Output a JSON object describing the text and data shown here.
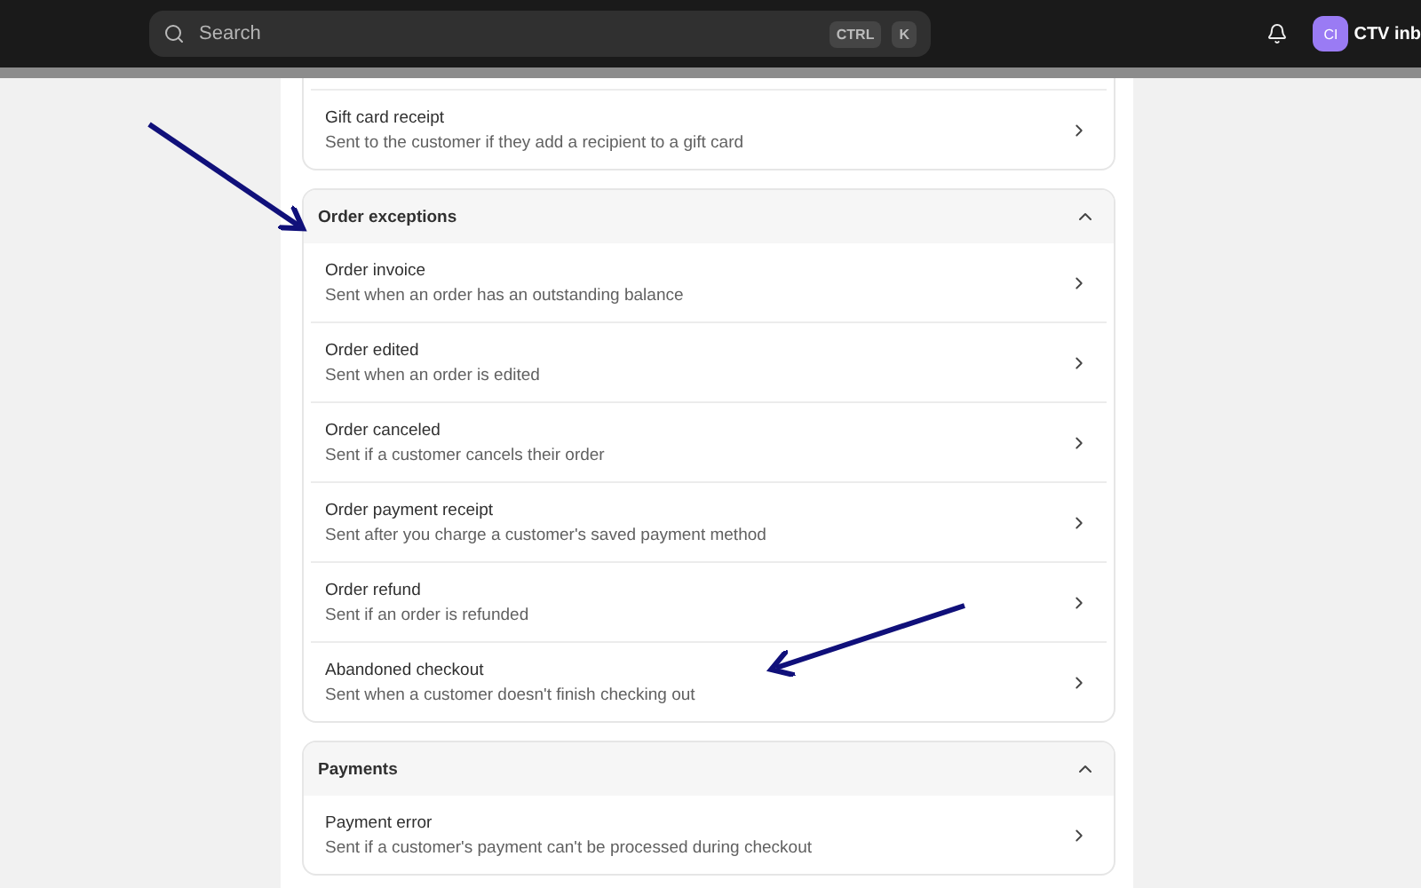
{
  "topbar": {
    "search": {
      "placeholder": "Search"
    },
    "shortcut_keys": [
      "CTRL",
      "K"
    ],
    "account": {
      "initials": "CI",
      "name": "CTV inb"
    }
  },
  "sections": [
    {
      "items": [
        {
          "name": "Gift card receipt",
          "description": "Sent to the customer if they add a recipient to a gift card"
        }
      ]
    },
    {
      "title": "Order exceptions",
      "expanded": true,
      "items": [
        {
          "name": "Order invoice",
          "description": "Sent when an order has an outstanding balance"
        },
        {
          "name": "Order edited",
          "description": "Sent when an order is edited"
        },
        {
          "name": "Order canceled",
          "description": "Sent if a customer cancels their order"
        },
        {
          "name": "Order payment receipt",
          "description": "Sent after you charge a customer's saved payment method"
        },
        {
          "name": "Order refund",
          "description": "Sent if an order is refunded"
        },
        {
          "name": "Abandoned checkout",
          "description": "Sent when a customer doesn't finish checking out"
        }
      ]
    },
    {
      "title": "Payments",
      "expanded": true,
      "items": [
        {
          "name": "Payment error",
          "description": "Sent if a customer's payment can't be processed during checkout"
        }
      ]
    }
  ]
}
